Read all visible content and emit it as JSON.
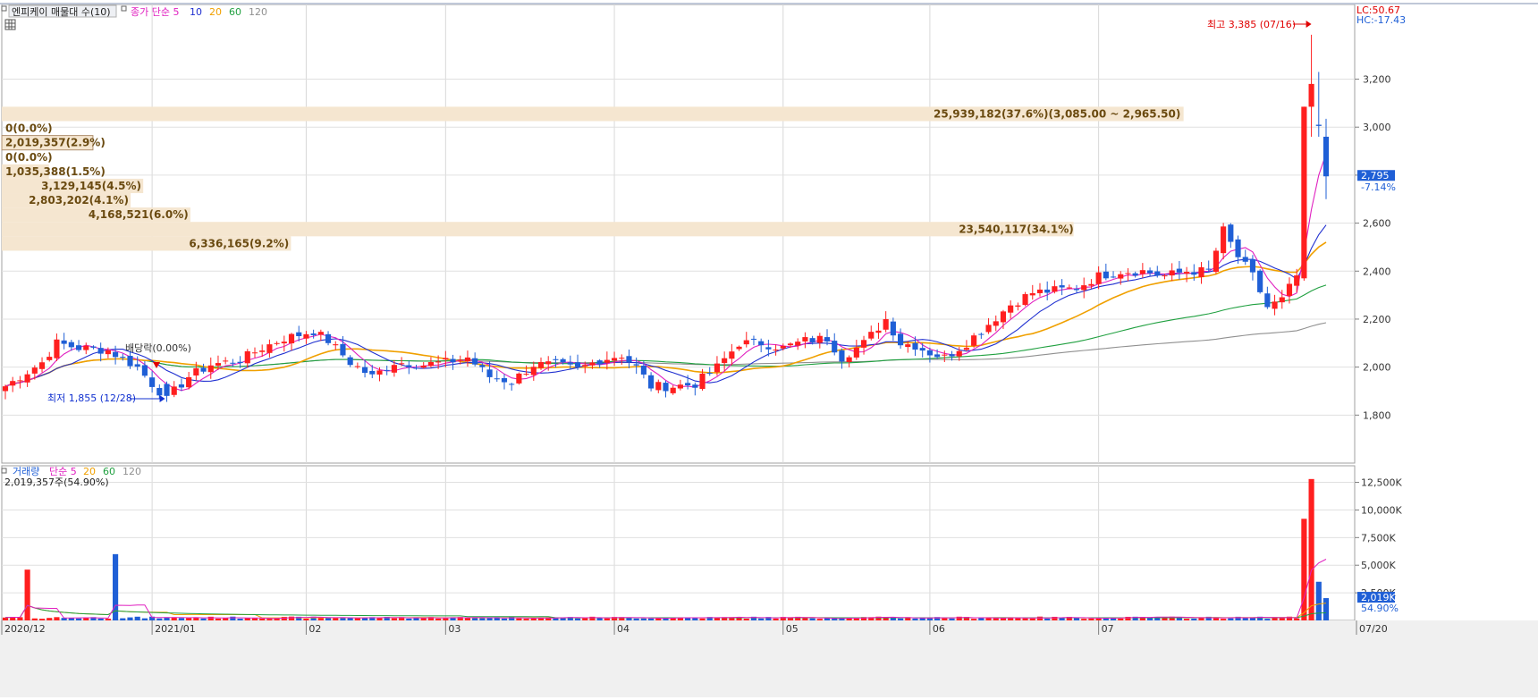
{
  "legend_price": {
    "title": "엔피케이 매물대 수(10)",
    "ma_label": "종가 단순 5",
    "periods": [
      "10",
      "20",
      "60",
      "120"
    ]
  },
  "legend_volume": {
    "title": "거래량",
    "ma_label": "단순 5",
    "periods": [
      "20",
      "60",
      "120"
    ],
    "current": "2,019,357주(54.90%)"
  },
  "top_right": {
    "lc": "LC:50.67",
    "hc": "HC:-17.43"
  },
  "price_marker": {
    "value": "2,795",
    "change": "-7.14%"
  },
  "volume_marker": {
    "value": "2,019K",
    "change": "54.90%"
  },
  "annotations": {
    "high": "최고 3,385 (07/16)",
    "low": "최저 1,855 (12/28)",
    "dividend": "배당락(0.00%)"
  },
  "colors": {
    "up": "#ff1f1f",
    "down": "#1f5fd6",
    "ma5": "#e020c0",
    "ma10": "#2030d0",
    "ma20": "#f0a000",
    "ma60": "#20a040",
    "ma120": "#909090",
    "profile": "#f5e6d0",
    "axis_text": "#333333"
  },
  "chart_data": {
    "type": "candlestick",
    "price_axis": {
      "min": 1600,
      "max": 3500,
      "ticks": [
        "1,800",
        "2,000",
        "2,200",
        "2,400",
        "2,600",
        "2,800",
        "3,000",
        "3,200"
      ]
    },
    "volume_axis": {
      "min": 0,
      "max": 14000,
      "ticks": [
        "2,500K",
        "5,000K",
        "7,500K",
        "10,000K",
        "12,500K"
      ]
    },
    "x_labels": [
      "2020/12",
      "2021/01",
      "02",
      "03",
      "04",
      "05",
      "06",
      "07",
      "07/20"
    ],
    "x_label_dates": [
      "2020/12",
      "2021/01",
      "2021/02",
      "2021/03",
      "2021/04",
      "2021/05",
      "2021/06",
      "2021/07",
      "2021/07/20"
    ],
    "volume_profile": [
      {
        "label": "25,939,182(37.6%)(3,085.00 ~ 2,965.50)",
        "pct": 37.6
      },
      {
        "label": "0(0.0%)",
        "pct": 0.0
      },
      {
        "label": "2,019,357(2.9%)",
        "pct": 2.9
      },
      {
        "label": "0(0.0%)",
        "pct": 0.0
      },
      {
        "label": "1,035,388(1.5%)",
        "pct": 1.5
      },
      {
        "label": "3,129,145(4.5%)",
        "pct": 4.5
      },
      {
        "label": "2,803,202(4.1%)",
        "pct": 4.1
      },
      {
        "label": "4,168,521(6.0%)",
        "pct": 6.0
      },
      {
        "label": "23,540,117(34.1%)",
        "pct": 34.1
      },
      {
        "label": "6,336,165(9.2%)",
        "pct": 9.2
      }
    ],
    "anchors": [
      [
        0,
        1920
      ],
      [
        3,
        1980
      ],
      [
        5,
        2020
      ],
      [
        7,
        2100
      ],
      [
        10,
        2080
      ],
      [
        14,
        2070
      ],
      [
        18,
        2000
      ],
      [
        20,
        1930
      ],
      [
        22,
        1870
      ],
      [
        25,
        1960
      ],
      [
        28,
        2010
      ],
      [
        32,
        2030
      ],
      [
        35,
        2080
      ],
      [
        38,
        2120
      ],
      [
        42,
        2150
      ],
      [
        44,
        2110
      ],
      [
        47,
        2020
      ],
      [
        50,
        1960
      ],
      [
        53,
        2020
      ],
      [
        57,
        2010
      ],
      [
        60,
        2020
      ],
      [
        63,
        2040
      ],
      [
        66,
        1960
      ],
      [
        69,
        1940
      ],
      [
        72,
        2010
      ],
      [
        75,
        2010
      ],
      [
        78,
        1990
      ],
      [
        81,
        2030
      ],
      [
        84,
        2050
      ],
      [
        86,
        2000
      ],
      [
        88,
        1920
      ],
      [
        91,
        1920
      ],
      [
        94,
        1930
      ],
      [
        97,
        2000
      ],
      [
        100,
        2100
      ],
      [
        103,
        2100
      ],
      [
        106,
        2080
      ],
      [
        109,
        2110
      ],
      [
        112,
        2120
      ],
      [
        114,
        2040
      ],
      [
        117,
        2100
      ],
      [
        120,
        2200
      ],
      [
        122,
        2100
      ],
      [
        124,
        2090
      ],
      [
        126,
        2060
      ],
      [
        128,
        2040
      ],
      [
        131,
        2100
      ],
      [
        134,
        2180
      ],
      [
        137,
        2260
      ],
      [
        140,
        2310
      ],
      [
        143,
        2320
      ],
      [
        146,
        2330
      ],
      [
        149,
        2380
      ],
      [
        152,
        2400
      ],
      [
        155,
        2400
      ],
      [
        158,
        2380
      ],
      [
        161,
        2400
      ],
      [
        164,
        2400
      ],
      [
        166,
        2570
      ],
      [
        168,
        2460
      ],
      [
        170,
        2380
      ],
      [
        172,
        2250
      ],
      [
        174,
        2280
      ],
      [
        176,
        2380
      ],
      [
        177,
        3085
      ],
      [
        178,
        3165
      ],
      [
        179,
        3010
      ],
      [
        180,
        2795
      ]
    ],
    "spikes": [
      [
        3,
        4600
      ],
      [
        15,
        6000
      ],
      [
        177,
        9200
      ],
      [
        178,
        12800
      ],
      [
        179,
        3500
      ],
      [
        180,
        2019
      ]
    ]
  }
}
